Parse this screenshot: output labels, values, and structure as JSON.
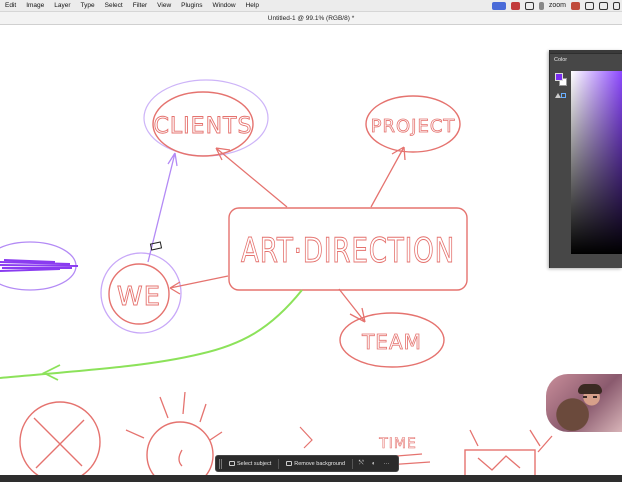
{
  "menubar": {
    "items": [
      "Edit",
      "Image",
      "Layer",
      "Type",
      "Select",
      "Filter",
      "View",
      "Plugins",
      "Window",
      "Help"
    ],
    "zoom_label": "zoom"
  },
  "document": {
    "title": "Untitled-1 @ 99.1% (RGB/8) *"
  },
  "sketch": {
    "words": {
      "clients": "CLIENTS",
      "project": "PROJECT",
      "art_direction": "ART·DIRECTION",
      "we": "WE",
      "team": "TEAM",
      "time": "TIME"
    },
    "colors": {
      "red_ink": "#e5736f",
      "purple_ink": "#b38af5",
      "purple_scribble": "#8a3cf0",
      "green_ink": "#8ce25a"
    }
  },
  "color_panel": {
    "title": "Color",
    "foreground_color": "#7a2df0",
    "background_color": "#ffffff"
  },
  "taskbar": {
    "select_subject": "Select subject",
    "remove_background": "Remove background",
    "more": "···"
  }
}
